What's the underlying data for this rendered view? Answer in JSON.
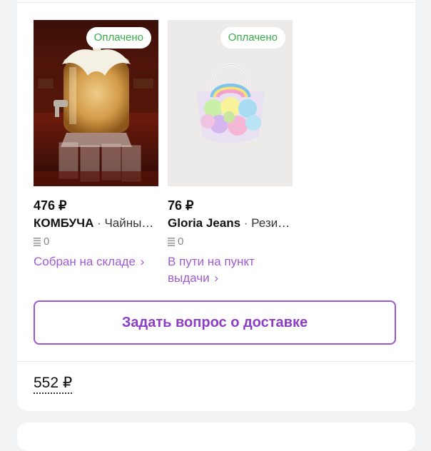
{
  "items": [
    {
      "badge": "Оплачено",
      "price": "476 ₽",
      "brand": "КОМБУЧА",
      "separator": " · ",
      "name": "Чайный гриб",
      "quantity": "0",
      "status": "Собран на складе",
      "status_arrow": "›",
      "image_icon": "kombucha-jar-image"
    },
    {
      "badge": "Оплачено",
      "price": "76 ₽",
      "brand": "Gloria Jeans",
      "separator": " · ",
      "name": "Резинки для волос",
      "quantity": "0",
      "status": "В пути на пункт выдачи",
      "status_arrow": "›",
      "image_icon": "hair-ties-bag-image"
    }
  ],
  "ask_button_label": "Задать вопрос о доставке",
  "total": "552 ₽",
  "colors": {
    "accent": "#9b56d4",
    "paid": "#37b04a",
    "status": "#a15bd0"
  }
}
